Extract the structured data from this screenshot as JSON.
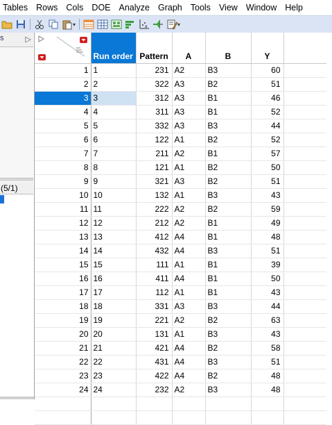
{
  "menu": [
    "Tables",
    "Rows",
    "Cols",
    "DOE",
    "Analyze",
    "Graph",
    "Tools",
    "View",
    "Window",
    "Help"
  ],
  "left_panel": {
    "top_label": "s",
    "bottom_label": "(5/1)"
  },
  "table": {
    "columns": [
      "Run order",
      "Pattern",
      "A",
      "B",
      "Y"
    ],
    "selected_row": 3,
    "rows": [
      {
        "n": "1",
        "run": "1",
        "pattern": "231",
        "a": "A2",
        "b": "B3",
        "y": "60"
      },
      {
        "n": "2",
        "run": "2",
        "pattern": "322",
        "a": "A3",
        "b": "B2",
        "y": "51"
      },
      {
        "n": "3",
        "run": "3",
        "pattern": "312",
        "a": "A3",
        "b": "B1",
        "y": "46"
      },
      {
        "n": "4",
        "run": "4",
        "pattern": "311",
        "a": "A3",
        "b": "B1",
        "y": "52"
      },
      {
        "n": "5",
        "run": "5",
        "pattern": "332",
        "a": "A3",
        "b": "B3",
        "y": "44"
      },
      {
        "n": "6",
        "run": "6",
        "pattern": "122",
        "a": "A1",
        "b": "B2",
        "y": "52"
      },
      {
        "n": "7",
        "run": "7",
        "pattern": "211",
        "a": "A2",
        "b": "B1",
        "y": "57"
      },
      {
        "n": "8",
        "run": "8",
        "pattern": "121",
        "a": "A1",
        "b": "B2",
        "y": "50"
      },
      {
        "n": "9",
        "run": "9",
        "pattern": "321",
        "a": "A3",
        "b": "B2",
        "y": "51"
      },
      {
        "n": "10",
        "run": "10",
        "pattern": "132",
        "a": "A1",
        "b": "B3",
        "y": "43"
      },
      {
        "n": "11",
        "run": "11",
        "pattern": "222",
        "a": "A2",
        "b": "B2",
        "y": "59"
      },
      {
        "n": "12",
        "run": "12",
        "pattern": "212",
        "a": "A2",
        "b": "B1",
        "y": "49"
      },
      {
        "n": "13",
        "run": "13",
        "pattern": "412",
        "a": "A4",
        "b": "B1",
        "y": "48"
      },
      {
        "n": "14",
        "run": "14",
        "pattern": "432",
        "a": "A4",
        "b": "B3",
        "y": "51"
      },
      {
        "n": "15",
        "run": "15",
        "pattern": "111",
        "a": "A1",
        "b": "B1",
        "y": "39"
      },
      {
        "n": "16",
        "run": "16",
        "pattern": "411",
        "a": "A4",
        "b": "B1",
        "y": "50"
      },
      {
        "n": "17",
        "run": "17",
        "pattern": "112",
        "a": "A1",
        "b": "B1",
        "y": "43"
      },
      {
        "n": "18",
        "run": "18",
        "pattern": "331",
        "a": "A3",
        "b": "B3",
        "y": "44"
      },
      {
        "n": "19",
        "run": "19",
        "pattern": "221",
        "a": "A2",
        "b": "B2",
        "y": "63"
      },
      {
        "n": "20",
        "run": "20",
        "pattern": "131",
        "a": "A1",
        "b": "B3",
        "y": "43"
      },
      {
        "n": "21",
        "run": "21",
        "pattern": "421",
        "a": "A4",
        "b": "B2",
        "y": "58"
      },
      {
        "n": "22",
        "run": "22",
        "pattern": "431",
        "a": "A4",
        "b": "B3",
        "y": "51"
      },
      {
        "n": "23",
        "run": "23",
        "pattern": "422",
        "a": "A4",
        "b": "B2",
        "y": "48"
      },
      {
        "n": "24",
        "run": "24",
        "pattern": "232",
        "a": "A2",
        "b": "B3",
        "y": "48"
      }
    ]
  },
  "colors": {
    "selection": "#0a78d6",
    "selected_cell": "#cfe2f4",
    "toolbar": "#dbe4f4"
  }
}
